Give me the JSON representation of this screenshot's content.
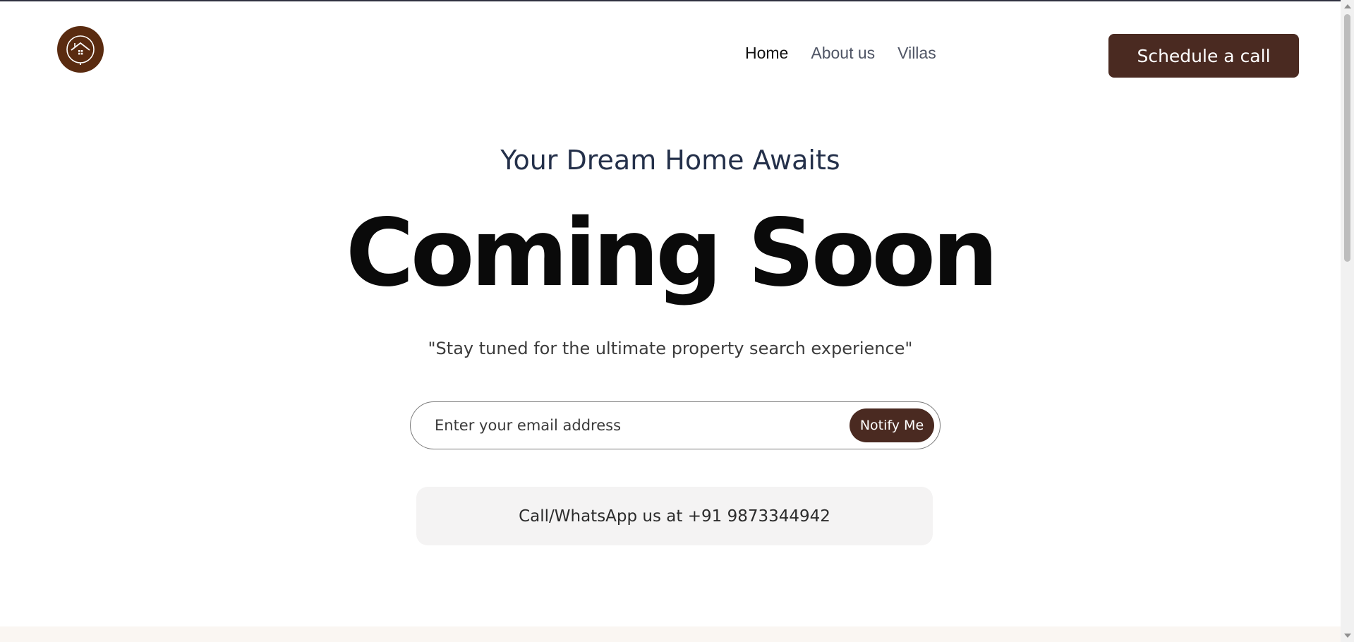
{
  "logo": {
    "icon": "house-logo-icon"
  },
  "nav": {
    "items": [
      {
        "label": "Home",
        "active": true
      },
      {
        "label": "About us",
        "active": false
      },
      {
        "label": "Villas",
        "active": false
      }
    ]
  },
  "header": {
    "cta_label": "Schedule a call"
  },
  "hero": {
    "subtitle": "Your Dream Home Awaits",
    "title": "Coming Soon",
    "tagline": "\"Stay tuned for the ultimate property search experience\""
  },
  "signup": {
    "email_placeholder": "Enter your email address",
    "email_value": "",
    "button_label": "Notify Me"
  },
  "contact": {
    "text": "Call/WhatsApp us at +91 9873344942"
  },
  "colors": {
    "brand": "#4a2a21",
    "logo_bg": "#5a2b10",
    "contact_bg": "#f4f3f3"
  }
}
